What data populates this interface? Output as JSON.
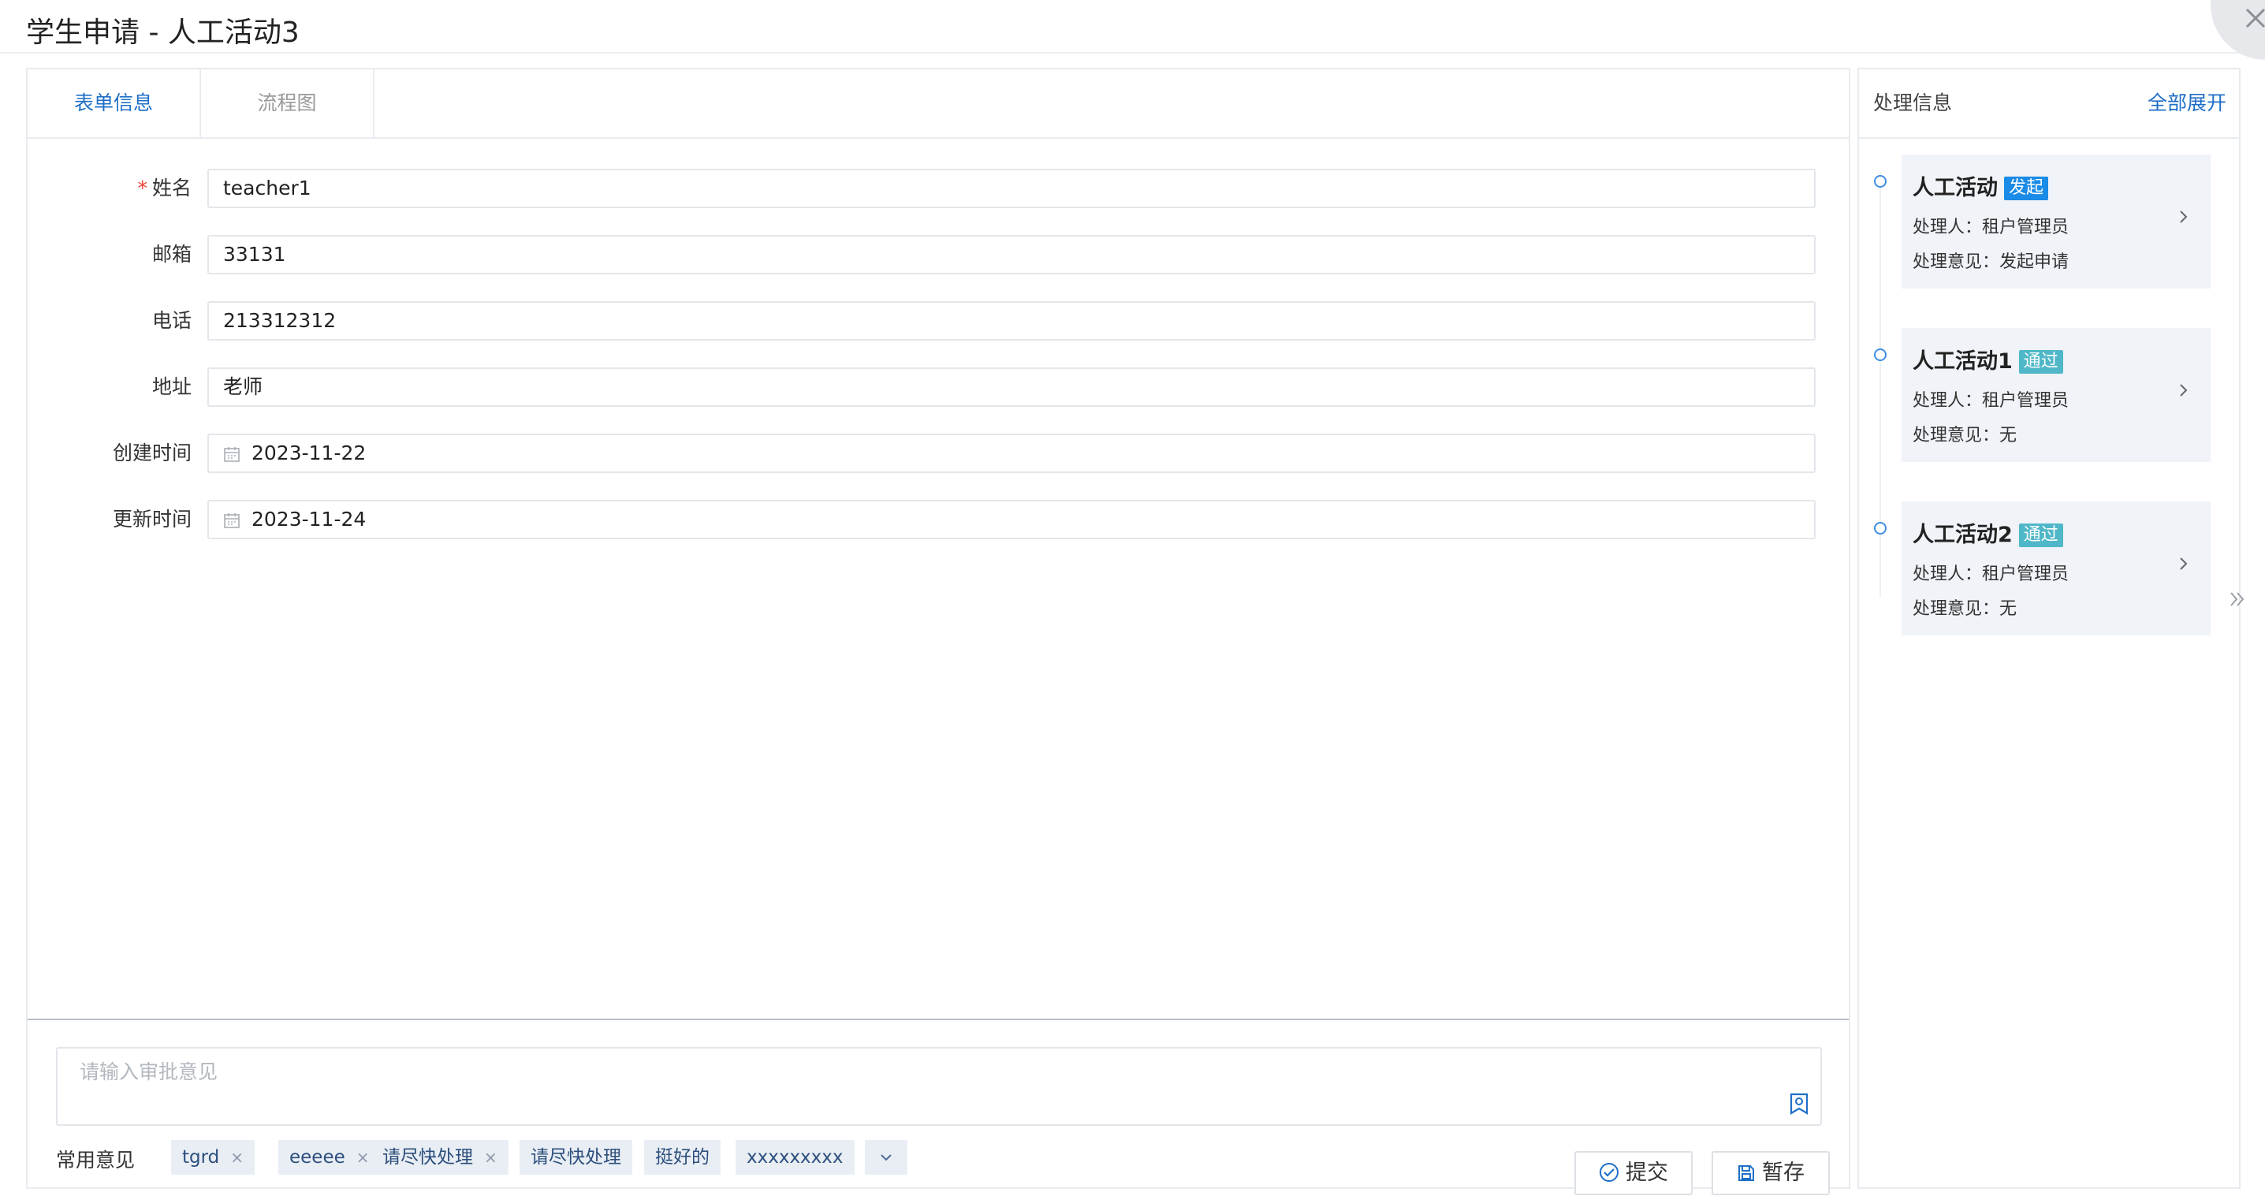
{
  "window": {
    "title": "学生申请 - 人工活动3",
    "close_icon": "close-icon"
  },
  "tabs": [
    {
      "label": "表单信息",
      "active": true
    },
    {
      "label": "流程图",
      "active": false
    }
  ],
  "form": {
    "fields": [
      {
        "label": "姓名",
        "required": true,
        "value": "teacher1"
      },
      {
        "label": "邮箱",
        "required": false,
        "value": "33131"
      },
      {
        "label": "电话",
        "required": false,
        "value": "213312312"
      },
      {
        "label": "地址",
        "required": false,
        "value": "老师"
      },
      {
        "label": "创建时间",
        "required": false,
        "value": "2023-11-22",
        "icon": "calendar-icon"
      },
      {
        "label": "更新时间",
        "required": false,
        "value": "2023-11-24",
        "icon": "calendar-icon"
      }
    ],
    "required_mark": "*"
  },
  "opinion": {
    "placeholder": "请输入审批意见",
    "common_label": "常用意见",
    "chips": [
      {
        "text": "tgrd",
        "removable": true
      },
      {
        "text": "eeeee",
        "removable": true
      },
      {
        "text": "请尽快处理",
        "removable": true
      },
      {
        "text": "请尽快处理",
        "removable": false
      },
      {
        "text": "挺好的",
        "removable": false
      },
      {
        "text": "xxxxxxxxx",
        "removable": false
      }
    ],
    "remove_glyph": "×",
    "submit_label": "提交",
    "save_label": "暂存"
  },
  "process": {
    "title": "处理信息",
    "expand_all": "全部展开",
    "handler_prefix": "处理人：",
    "opinion_prefix": "处理意见：",
    "records": [
      {
        "name": "人工活动",
        "badge": "发起",
        "badge_color": "#1a8be6",
        "handler": "租户管理员",
        "opinion": "发起申请"
      },
      {
        "name": "人工活动1",
        "badge": "通过",
        "badge_color": "#4fb7c8",
        "handler": "租户管理员",
        "opinion": "无"
      },
      {
        "name": "人工活动2",
        "badge": "通过",
        "badge_color": "#4fb7c8",
        "handler": "租户管理员",
        "opinion": "无"
      }
    ]
  },
  "colors": {
    "accent": "#1f6fc7",
    "required": "#f04134",
    "chip_bg": "#e9eef5",
    "card_bg": "#f0f3f8"
  }
}
